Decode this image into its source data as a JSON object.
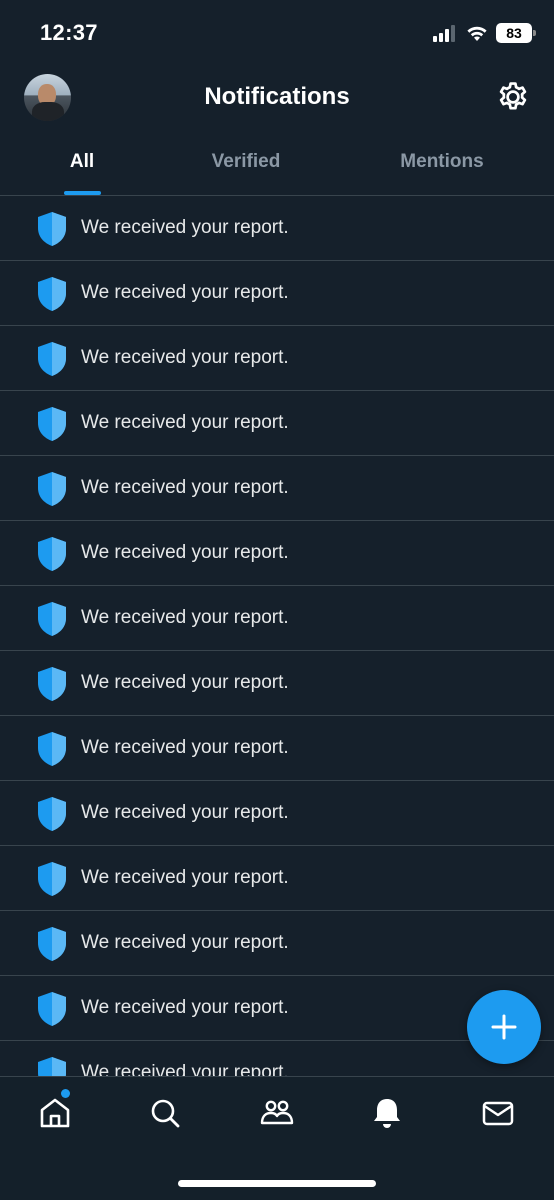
{
  "status_bar": {
    "time": "12:37",
    "battery": "83"
  },
  "header": {
    "title": "Notifications"
  },
  "tabs": [
    {
      "label": "All",
      "active": true
    },
    {
      "label": "Verified",
      "active": false
    },
    {
      "label": "Mentions",
      "active": false
    }
  ],
  "notifications": [
    {
      "icon": "shield-icon",
      "text": "We received your report."
    },
    {
      "icon": "shield-icon",
      "text": "We received your report."
    },
    {
      "icon": "shield-icon",
      "text": "We received your report."
    },
    {
      "icon": "shield-icon",
      "text": "We received your report."
    },
    {
      "icon": "shield-icon",
      "text": "We received your report."
    },
    {
      "icon": "shield-icon",
      "text": "We received your report."
    },
    {
      "icon": "shield-icon",
      "text": "We received your report."
    },
    {
      "icon": "shield-icon",
      "text": "We received your report."
    },
    {
      "icon": "shield-icon",
      "text": "We received your report."
    },
    {
      "icon": "shield-icon",
      "text": "We received your report."
    },
    {
      "icon": "shield-icon",
      "text": "We received your report."
    },
    {
      "icon": "shield-icon",
      "text": "We received your report."
    },
    {
      "icon": "shield-icon",
      "text": "We received your report."
    },
    {
      "icon": "shield-icon",
      "text": "We received your report."
    }
  ],
  "bottom_nav": [
    {
      "icon": "home-icon",
      "active": true,
      "has_badge": true
    },
    {
      "icon": "search-icon",
      "active": false
    },
    {
      "icon": "communities-icon",
      "active": false
    },
    {
      "icon": "bell-icon",
      "active": false
    },
    {
      "icon": "mail-icon",
      "active": false
    }
  ],
  "colors": {
    "background": "#15202b",
    "accent": "#1d9bf0",
    "divider": "#38444d",
    "muted_text": "#8b98a5",
    "shield": "#4aa8f0"
  }
}
